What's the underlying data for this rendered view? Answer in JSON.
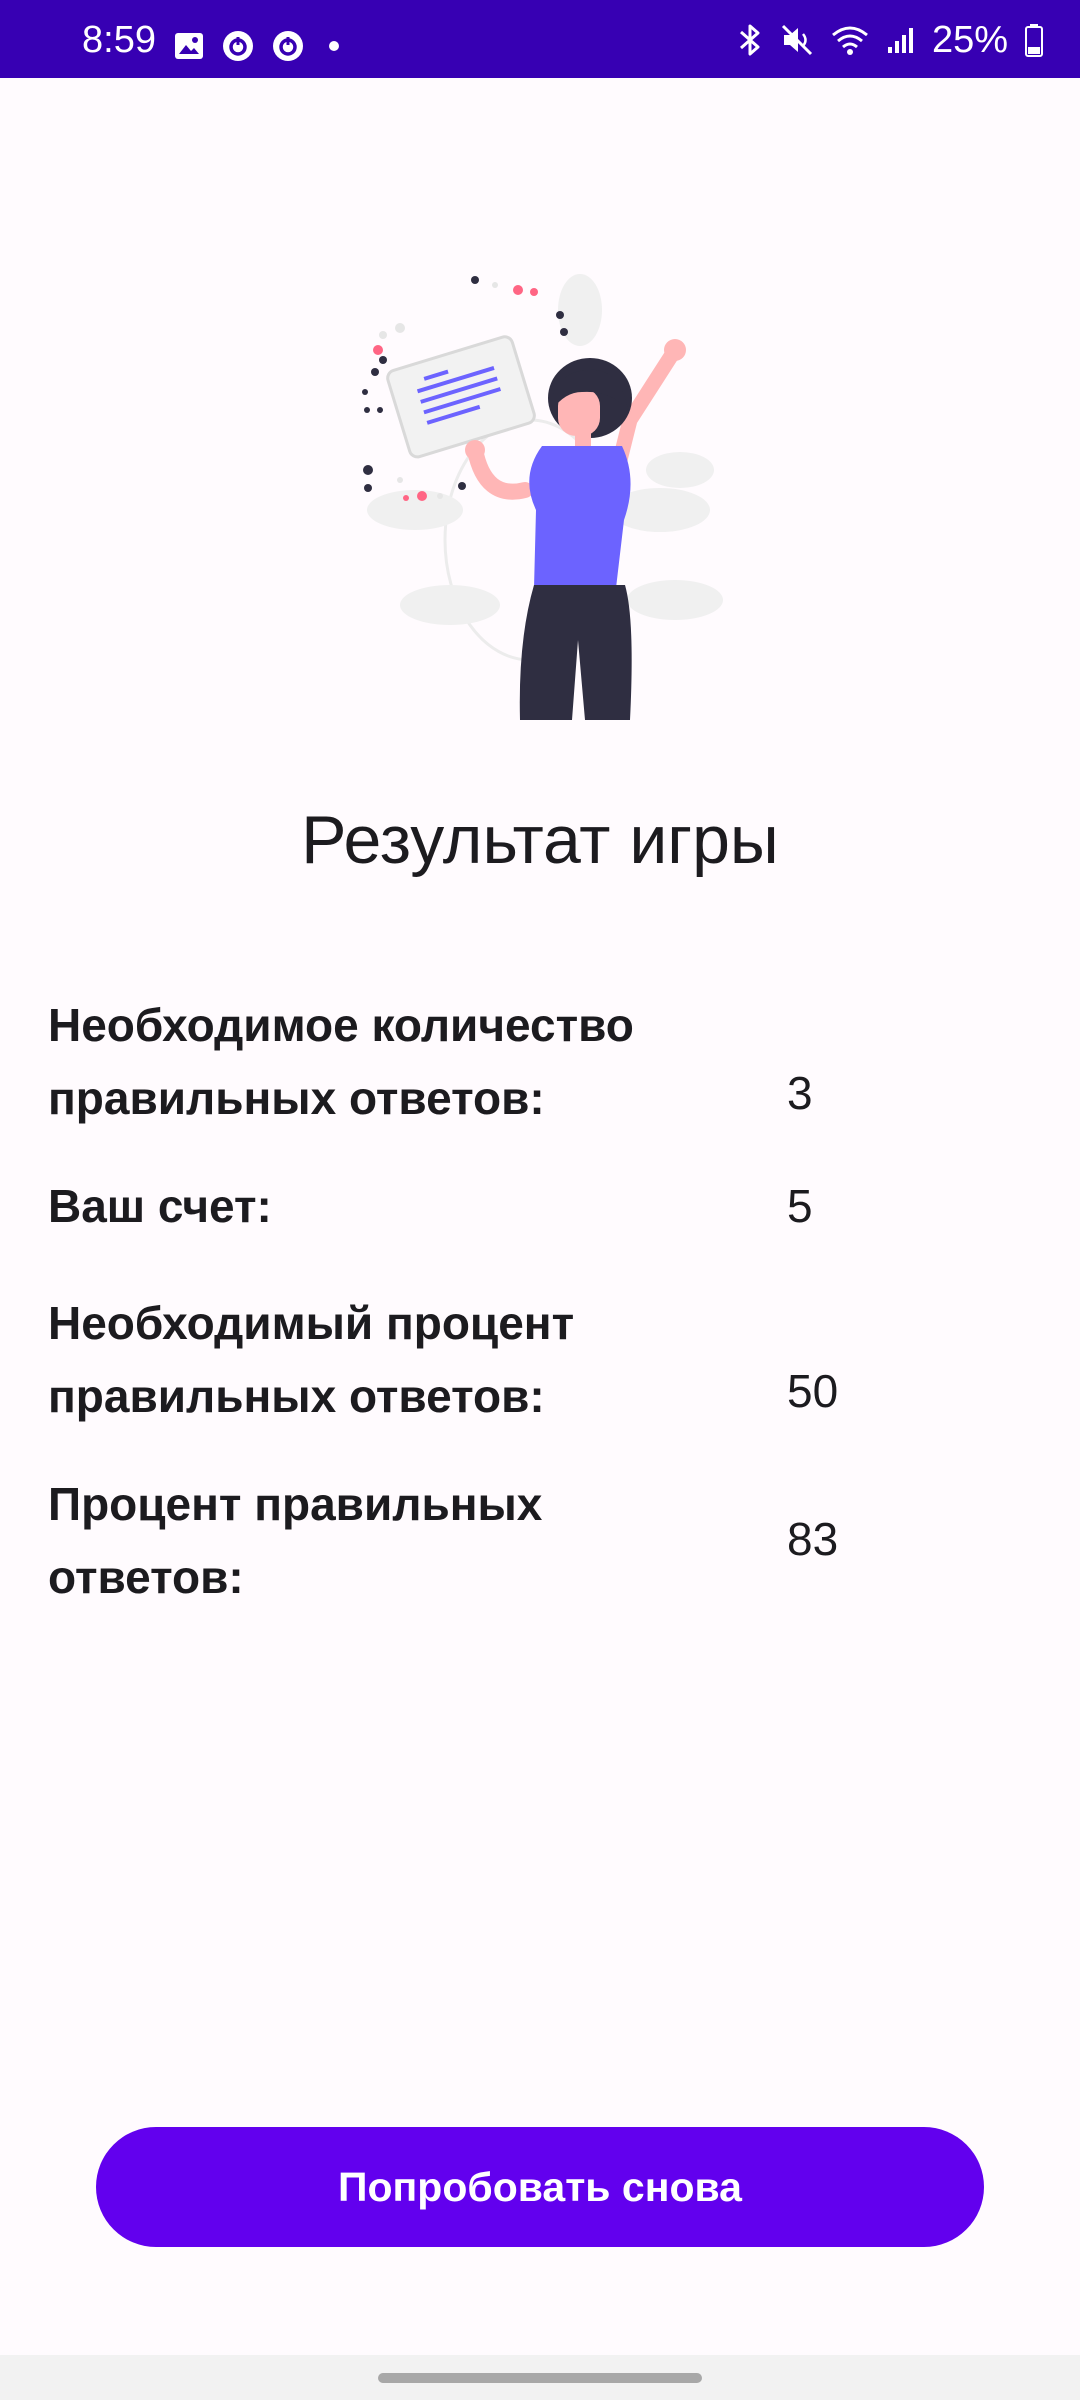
{
  "status_bar": {
    "time": "8:59",
    "left_icons": [
      "gallery-icon",
      "app-icon",
      "app-icon",
      "dot-icon"
    ],
    "right_icons": [
      "bluetooth-icon",
      "mute-icon",
      "wifi-icon",
      "signal-icon"
    ],
    "battery": "25%"
  },
  "illustration": {
    "icon": "celebrating-woman-illustration",
    "colors": {
      "accent": "#6c63ff",
      "hair": "#2f2e41",
      "skin": "#ffb6b6",
      "pants": "#2f2e41",
      "leaves": "#f0f0f0",
      "pink": "#ff6584"
    }
  },
  "title": "Результат игры",
  "results": [
    {
      "label": "Необходимое количество правильных ответов:",
      "value": "3"
    },
    {
      "label": "Ваш счет:",
      "value": "5"
    },
    {
      "label": "Необходимый процент правильных ответов:",
      "value": "50"
    },
    {
      "label": "Процент правильных ответов:",
      "value": "83"
    }
  ],
  "button": {
    "label": "Попробовать снова",
    "color": "#6200ee"
  },
  "colors": {
    "status_bar": "#3700b3",
    "background": "#fffbfe",
    "text": "#1c1b1f"
  }
}
